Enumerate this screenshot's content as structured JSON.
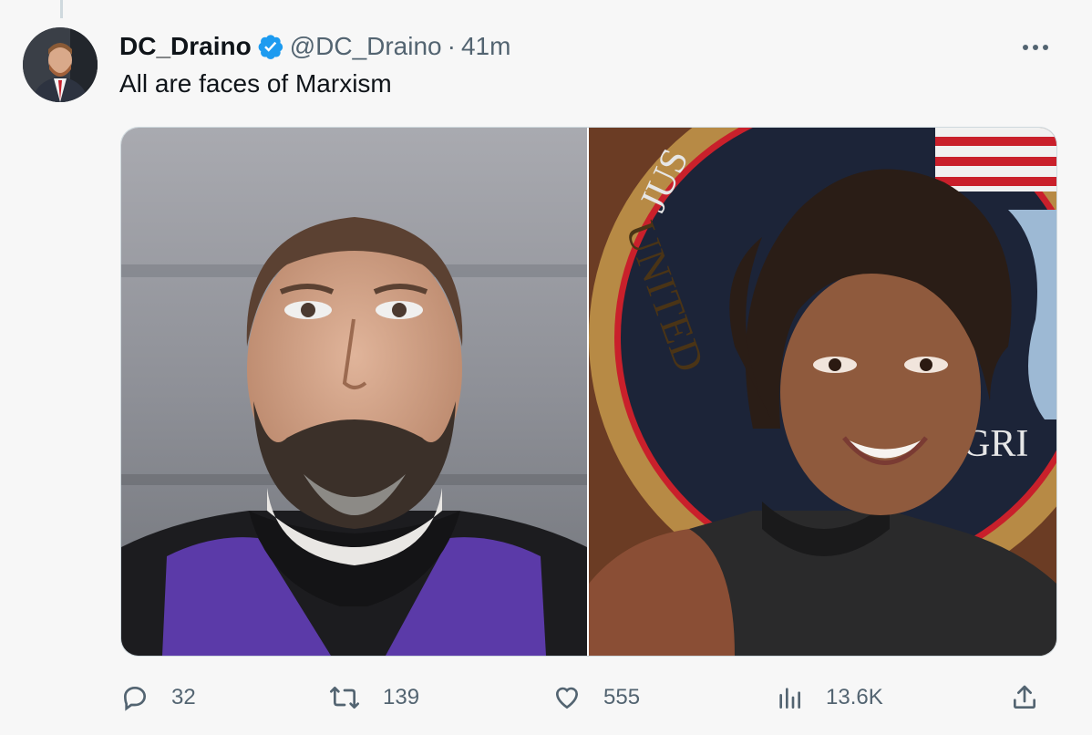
{
  "tweet": {
    "display_name": "DC_Draino",
    "handle": "@DC_Draino",
    "separator": "·",
    "time": "41m",
    "text": "All are faces of Marxism",
    "verified": true
  },
  "media": {
    "photos": [
      {
        "description_icon": "man-portrait-photo"
      },
      {
        "description_icon": "woman-portrait-photo",
        "seal_text": [
          "JUS",
          "UNITED",
          "GRI"
        ]
      }
    ]
  },
  "actions": {
    "replies": "32",
    "retweets": "139",
    "likes": "555",
    "views": "13.6K"
  },
  "colors": {
    "verified": "#1d9bf0",
    "secondary_text": "#536471",
    "robe_purple": "#5b3aa8"
  }
}
